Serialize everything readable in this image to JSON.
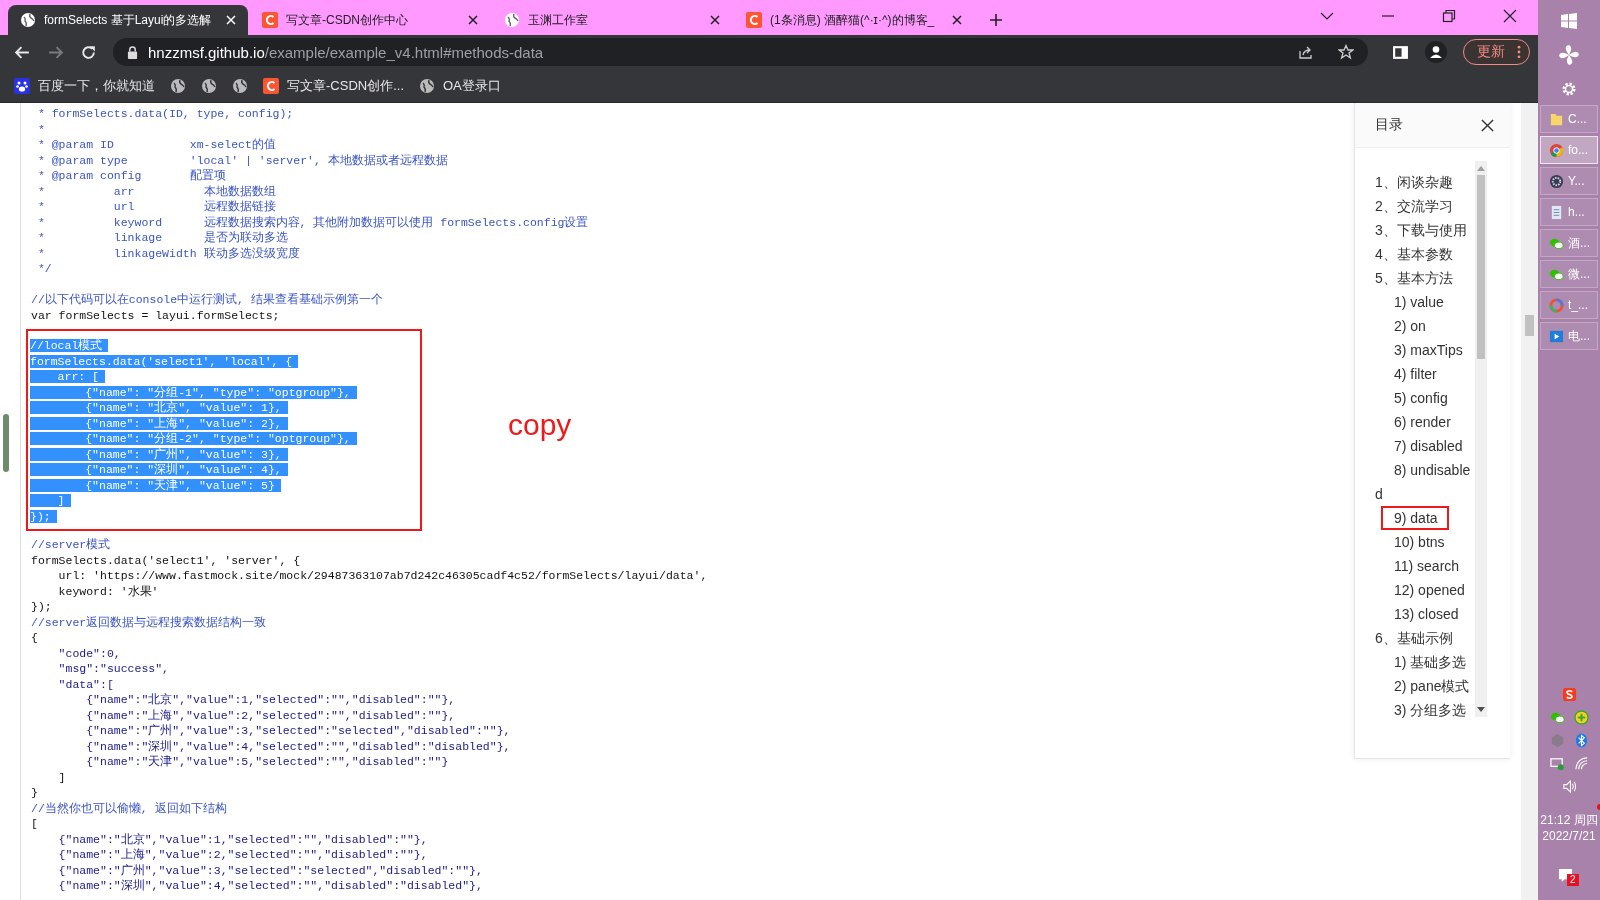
{
  "tabs": [
    {
      "title": "formSelects 基于Layui的多选解",
      "kind": "globe",
      "selected": true
    },
    {
      "title": "写文章-CSDN创作中心",
      "kind": "csdn",
      "selected": false
    },
    {
      "title": "玉渊工作室",
      "kind": "globe",
      "selected": false
    },
    {
      "title": "(1条消息) 酒醉猫(^·ɪ·^)的博客_",
      "kind": "csdn",
      "selected": false
    }
  ],
  "address": {
    "host": "hnzzmsf.github.io",
    "path": "/example/example_v4.html#methods-data"
  },
  "update_button": "更新",
  "bookmarks": [
    {
      "kind": "baidu",
      "label": "百度一下，你就知道"
    },
    {
      "kind": "globe"
    },
    {
      "kind": "globe"
    },
    {
      "kind": "globe"
    },
    {
      "kind": "csdn",
      "label": "写文章-CSDN创作..."
    },
    {
      "kind": "globe",
      "label": "OA登录口"
    }
  ],
  "code": {
    "doc_comment": [
      {
        "kind": "comment",
        "text": " * formSelects.data(ID, type, config);"
      },
      {
        "kind": "comment",
        "text": " *"
      },
      {
        "kind": "comment",
        "text": " * @param ID           xm-select的值"
      },
      {
        "kind": "comment",
        "text": " * @param type         'local' | 'server', 本地数据或者远程数据"
      },
      {
        "kind": "comment",
        "text": " * @param config       配置项"
      },
      {
        "kind": "comment",
        "text": " *          arr          本地数据数组"
      },
      {
        "kind": "comment",
        "text": " *          url          远程数据链接"
      },
      {
        "kind": "comment",
        "text": " *          keyword      远程数据搜索内容, 其他附加数据可以使用 formSelects.config设置"
      },
      {
        "kind": "comment",
        "text": " *          linkage      是否为联动多选"
      },
      {
        "kind": "comment",
        "text": " *          linkageWidth 联动多选没级宽度"
      },
      {
        "kind": "comment",
        "text": " */"
      }
    ],
    "intro": [
      {
        "kind": "comment",
        "text": "//以下代码可以在console中运行测试, 结果查看基础示例第一个"
      },
      {
        "kind": "plain",
        "text": "var formSelects = layui.formSelects;"
      }
    ],
    "copied": {
      "label": "copy",
      "lines": [
        {
          "text": "//local模式"
        },
        {
          "text": "formSelects.data('select1', 'local', {"
        },
        {
          "text": "    arr: ["
        },
        {
          "text": "        {\"name\": \"分组-1\", \"type\": \"optgroup\"},"
        },
        {
          "text": "        {\"name\": \"北京\", \"value\": 1},"
        },
        {
          "text": "        {\"name\": \"上海\", \"value\": 2},"
        },
        {
          "text": "        {\"name\": \"分组-2\", \"type\": \"optgroup\"},"
        },
        {
          "text": "        {\"name\": \"广州\", \"value\": 3},"
        },
        {
          "text": "        {\"name\": \"深圳\", \"value\": 4},"
        },
        {
          "text": "        {\"name\": \"天津\", \"value\": 5}"
        },
        {
          "text": "    ]"
        },
        {
          "text": "});"
        }
      ]
    },
    "after": [
      {
        "kind": "comment",
        "text": "//server模式"
      },
      {
        "kind": "plain",
        "text": "formSelects.data('select1', 'server', {"
      },
      {
        "kind": "plain",
        "text": "    url: 'https://www.fastmock.site/mock/29487363107ab7d242c46305cadf4c52/formSelects/layui/data',"
      },
      {
        "kind": "plain",
        "text": "    keyword: '水果'"
      },
      {
        "kind": "plain",
        "text": "});"
      },
      {
        "kind": "comment",
        "text": "//server返回数据与远程搜索数据结构一致"
      },
      {
        "kind": "plain",
        "text": "{"
      },
      {
        "kind": "data",
        "text": "    \"code\":0,"
      },
      {
        "kind": "data",
        "text": "    \"msg\":\"success\","
      },
      {
        "kind": "data",
        "text": "    \"data\":["
      },
      {
        "kind": "data",
        "text": "        {\"name\":\"北京\",\"value\":1,\"selected\":\"\",\"disabled\":\"\"},"
      },
      {
        "kind": "data",
        "text": "        {\"name\":\"上海\",\"value\":2,\"selected\":\"\",\"disabled\":\"\"},"
      },
      {
        "kind": "data",
        "text": "        {\"name\":\"广州\",\"value\":3,\"selected\":\"selected\",\"disabled\":\"\"},"
      },
      {
        "kind": "data",
        "text": "        {\"name\":\"深圳\",\"value\":4,\"selected\":\"\",\"disabled\":\"disabled\"},"
      },
      {
        "kind": "data",
        "text": "        {\"name\":\"天津\",\"value\":5,\"selected\":\"\",\"disabled\":\"\"}"
      },
      {
        "kind": "plain",
        "text": "    ]"
      },
      {
        "kind": "plain",
        "text": "}"
      },
      {
        "kind": "comment",
        "text": "//当然你也可以偷懒, 返回如下结构"
      },
      {
        "kind": "plain",
        "text": "["
      },
      {
        "kind": "data",
        "text": "    {\"name\":\"北京\",\"value\":1,\"selected\":\"\",\"disabled\":\"\"},"
      },
      {
        "kind": "data",
        "text": "    {\"name\":\"上海\",\"value\":2,\"selected\":\"\",\"disabled\":\"\"},"
      },
      {
        "kind": "data",
        "text": "    {\"name\":\"广州\",\"value\":3,\"selected\":\"selected\",\"disabled\":\"\"},"
      },
      {
        "kind": "data",
        "text": "    {\"name\":\"深圳\",\"value\":4,\"selected\":\"\",\"disabled\":\"disabled\"},"
      }
    ]
  },
  "toc": {
    "title": "目录",
    "items": [
      {
        "label": "1、闲谈杂趣",
        "marked": false
      },
      {
        "label": "2、交流学习",
        "marked": false
      },
      {
        "label": "3、下载与使用",
        "marked": false
      },
      {
        "label": "4、基本参数",
        "marked": false
      },
      {
        "label": "5、基本方法",
        "marked": false,
        "children": [
          {
            "label": "1) value",
            "marked": false
          },
          {
            "label": "2) on",
            "marked": false
          },
          {
            "label": "3) maxTips",
            "marked": false
          },
          {
            "label": "4) filter",
            "marked": false
          },
          {
            "label": "5) config",
            "marked": false
          },
          {
            "label": "6) render",
            "marked": false
          },
          {
            "label": "7) disabled",
            "marked": false
          },
          {
            "label": "8) undisabled",
            "marked": false
          },
          {
            "label": "9) data",
            "marked": true
          },
          {
            "label": "10) btns",
            "marked": false
          },
          {
            "label": "11) search",
            "marked": false
          },
          {
            "label": "12) opened",
            "marked": false
          },
          {
            "label": "13) closed",
            "marked": false
          }
        ]
      },
      {
        "label": "6、基础示例",
        "marked": false,
        "children": [
          {
            "label": "1) 基础多选",
            "marked": false
          },
          {
            "label": "2) pane模式",
            "marked": false
          },
          {
            "label": "3) 分组多选",
            "marked": false
          }
        ]
      }
    ]
  },
  "taskbar": {
    "tasks": [
      {
        "kind": "folder",
        "label": "C...",
        "selected": false
      },
      {
        "kind": "chrome",
        "label": "fo...",
        "selected": true
      },
      {
        "kind": "gear",
        "label": "Y...",
        "selected": false
      },
      {
        "kind": "notepad",
        "label": "h...",
        "selected": false
      },
      {
        "kind": "chat",
        "label": "酒...",
        "selected": false
      },
      {
        "kind": "chat",
        "label": "微...",
        "selected": false
      },
      {
        "kind": "ring",
        "label": "t_...",
        "selected": false
      },
      {
        "kind": "video",
        "label": "电...",
        "selected": false
      }
    ],
    "clock": {
      "time": "21:12 周四",
      "date": "2022/7/21"
    },
    "notification_count": "2"
  }
}
